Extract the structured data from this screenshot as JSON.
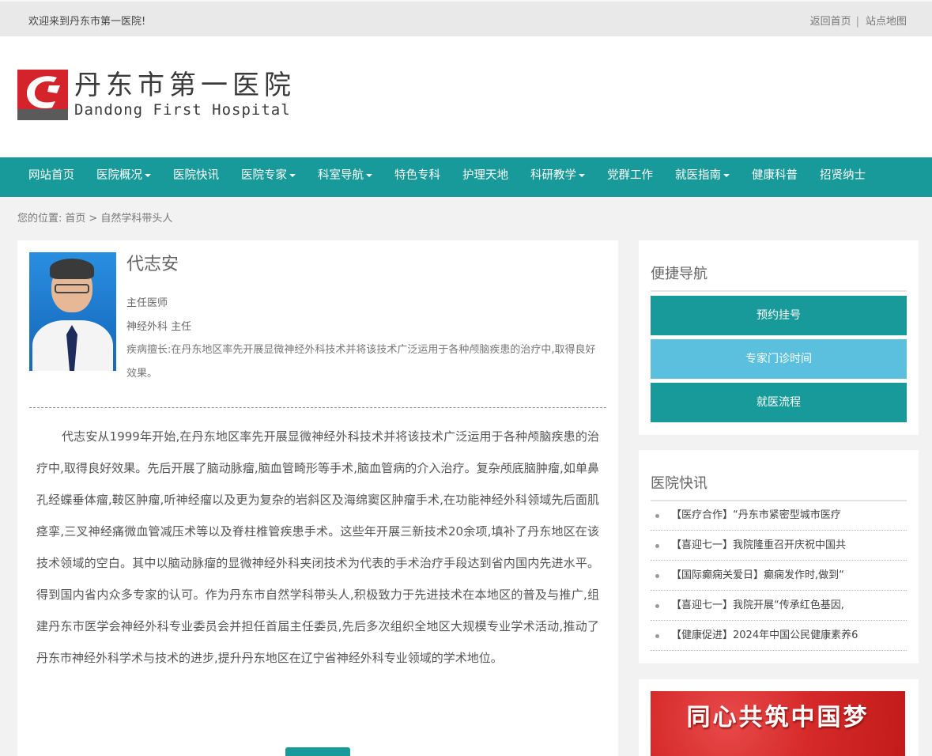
{
  "topbar": {
    "welcome": "欢迎来到丹东市第一医院!",
    "home_link": "返回首页",
    "separator": "|",
    "sitemap_link": "站点地图"
  },
  "header": {
    "logo_cn": "丹东市第一医院",
    "logo_en": "Dandong First Hospital"
  },
  "nav": {
    "items": [
      {
        "label": "网站首页",
        "dropdown": false
      },
      {
        "label": "医院概况",
        "dropdown": true
      },
      {
        "label": "医院快讯",
        "dropdown": false
      },
      {
        "label": "医院专家",
        "dropdown": true
      },
      {
        "label": "科室导航",
        "dropdown": true
      },
      {
        "label": "特色专科",
        "dropdown": false
      },
      {
        "label": "护理天地",
        "dropdown": false
      },
      {
        "label": "科研教学",
        "dropdown": true
      },
      {
        "label": "党群工作",
        "dropdown": false
      },
      {
        "label": "就医指南",
        "dropdown": true
      },
      {
        "label": "健康科普",
        "dropdown": false
      },
      {
        "label": "招贤纳士",
        "dropdown": false
      }
    ]
  },
  "breadcrumb": {
    "prefix": "您的位置:",
    "home": "首页",
    "sep": ">",
    "current": "自然学科带头人"
  },
  "doctor": {
    "name": "代志安",
    "title": "主任医师",
    "dept": "神经外科 主任",
    "specialty": "疾病擅长:在丹东地区率先开展显微神经外科技术并将该技术广泛运用于各种颅脑疾患的治疗中,取得良好效果。",
    "bio": "代志安从1999年开始,在丹东地区率先开展显微神经外科技术并将该技术广泛运用于各种颅脑疾患的治疗中,取得良好效果。先后开展了脑动脉瘤,脑血管畸形等手术,脑血管病的介入治疗。复杂颅底脑肿瘤,如单鼻孔经蝶垂体瘤,鞍区肿瘤,听神经瘤以及更为复杂的岩斜区及海绵窦区肿瘤手术,在功能神经外科领域先后面肌痉挛,三叉神经痛微血管减压术等以及脊柱椎管疾患手术。这些年开展三新技术20余项,填补了丹东地区在该技术领域的空白。其中以脑动脉瘤的显微神经外科夹闭技术为代表的手术治疗手段达到省内国内先进水平。得到国内省内众多专家的认可。作为丹东市自然学科带头人,积极致力于先进技术在本地区的普及与推广,组建丹东市医学会神经外科专业委员会并担任首届主任委员,先后多次组织全地区大规模专业学术活动,推动了丹东市神经外科学术与技术的进步,提升丹东地区在辽宁省神经外科专业领域的学术地位。"
  },
  "quicknav": {
    "title": "便捷导航",
    "buttons": [
      "预约挂号",
      "专家门诊时间",
      "就医流程"
    ]
  },
  "news": {
    "title": "医院快讯",
    "items": [
      "【医疗合作】“丹东市紧密型城市医疗",
      "【喜迎七一】我院隆重召开庆祝中国共",
      "【国际癫痫关爱日】癫痫发作时,做到“",
      "【喜迎七一】我院开展“传承红色基因,",
      "【健康促进】2024年中国公民健康素养6"
    ]
  },
  "banner": {
    "text": "同心共筑中国梦"
  },
  "colors": {
    "accent": "#199a9a",
    "light_button": "#5bc0de",
    "logo_red": "#d4232a"
  }
}
